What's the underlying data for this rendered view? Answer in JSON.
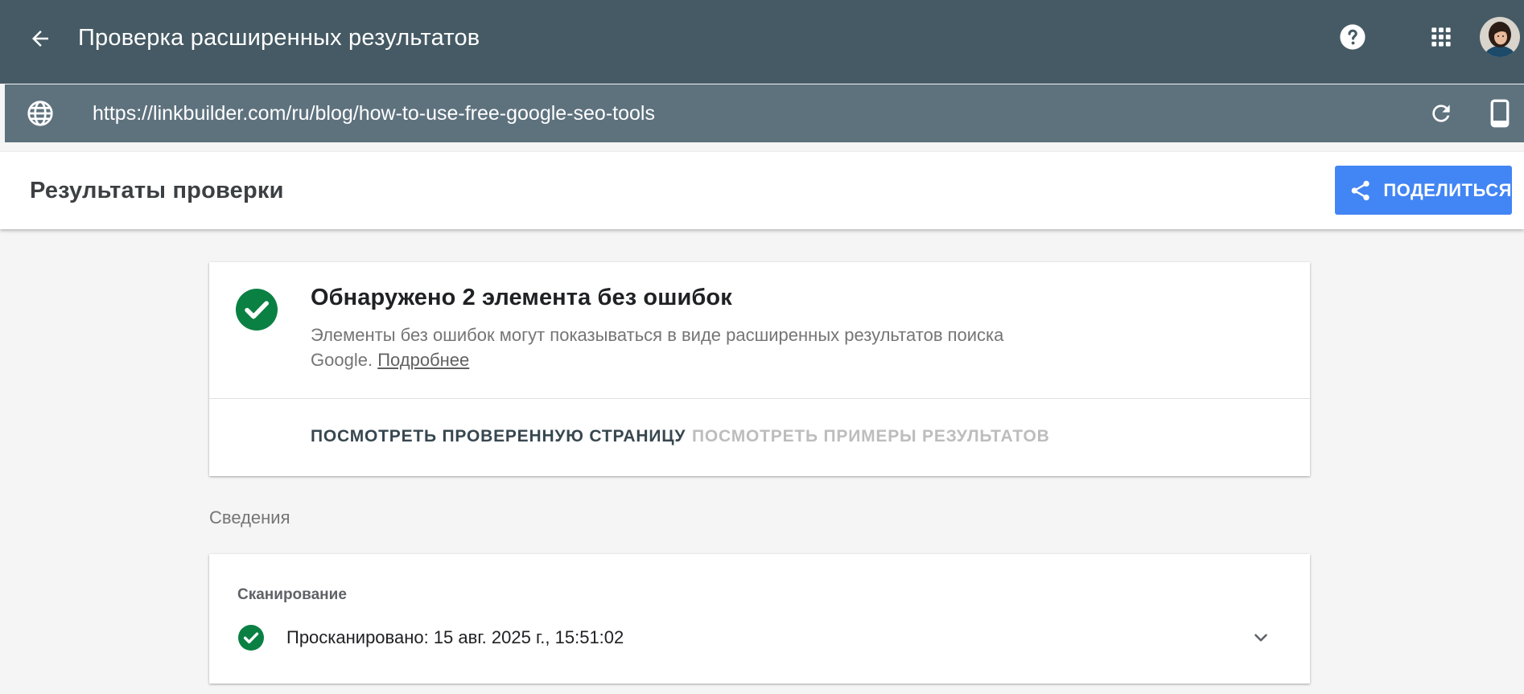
{
  "app_bar": {
    "title": "Проверка расширенных результатов"
  },
  "url_bar": {
    "url": "https://linkbuilder.com/ru/blog/how-to-use-free-google-seo-tools"
  },
  "results_header": {
    "title": "Результаты проверки",
    "share_label": "ПОДЕЛИТЬСЯ"
  },
  "summary": {
    "title": "Обнаружено 2 элемента без ошибок",
    "description": "Элементы без ошибок могут показываться в виде расширенных результатов поиска Google.",
    "more_link": "Подробнее",
    "action_view_page": "ПОСМОТРЕТЬ ПРОВЕРЕННУЮ СТРАНИЦУ",
    "action_view_examples": "ПОСМОТРЕТЬ ПРИМЕРЫ РЕЗУЛЬТАТОВ"
  },
  "details": {
    "section_label": "Сведения",
    "crawl_heading": "Сканирование",
    "crawl_status": "Просканировано: 15 авг. 2025 г., 15:51:02"
  },
  "colors": {
    "app_bar_bg": "#455a64",
    "url_bar_bg": "#5e727e",
    "share_button": "#4285f4",
    "success_green": "#0b8043"
  },
  "icons": {
    "back": "arrow-back-icon",
    "help": "help-icon",
    "apps": "apps-grid-icon",
    "globe": "globe-icon",
    "reload": "reload-icon",
    "device": "smartphone-icon",
    "share": "share-icon",
    "success": "check-circle-icon",
    "expand": "chevron-down-icon"
  }
}
